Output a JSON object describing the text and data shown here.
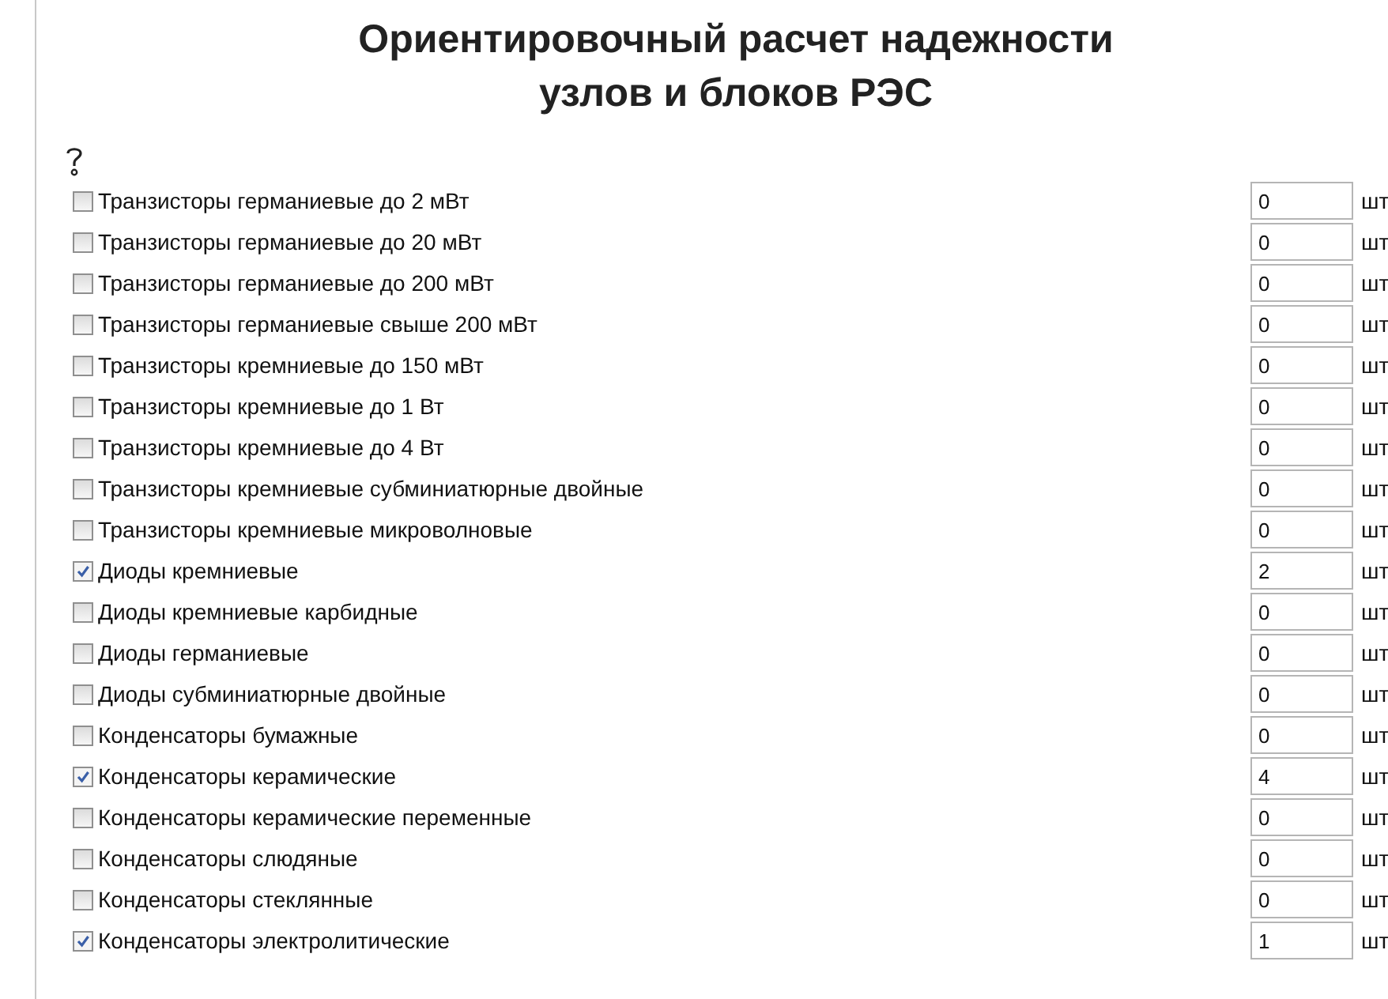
{
  "title": "Ориентировочный расчет надежности узлов и блоков РЭС",
  "items": [
    {
      "label": "Транзисторы германиевые до 2 мВт",
      "checked": false,
      "value": "0",
      "unit": "шт"
    },
    {
      "label": "Транзисторы германиевые до 20 мВт",
      "checked": false,
      "value": "0",
      "unit": "шт"
    },
    {
      "label": "Транзисторы германиевые до 200 мВт",
      "checked": false,
      "value": "0",
      "unit": "шт"
    },
    {
      "label": "Транзисторы германиевые свыше 200 мВт",
      "checked": false,
      "value": "0",
      "unit": "шт"
    },
    {
      "label": "Транзисторы кремниевые до 150 мВт",
      "checked": false,
      "value": "0",
      "unit": "шт"
    },
    {
      "label": "Транзисторы кремниевые до 1 Вт",
      "checked": false,
      "value": "0",
      "unit": "шт"
    },
    {
      "label": "Транзисторы кремниевые до 4 Вт",
      "checked": false,
      "value": "0",
      "unit": "шт"
    },
    {
      "label": "Транзисторы кремниевые субминиатюрные двойные",
      "checked": false,
      "value": "0",
      "unit": "шт"
    },
    {
      "label": "Транзисторы кремниевые микроволновые",
      "checked": false,
      "value": "0",
      "unit": "шт"
    },
    {
      "label": "Диоды кремниевые",
      "checked": true,
      "value": "2",
      "unit": "шт"
    },
    {
      "label": "Диоды кремниевые карбидные",
      "checked": false,
      "value": "0",
      "unit": "шт"
    },
    {
      "label": "Диоды германиевые",
      "checked": false,
      "value": "0",
      "unit": "шт"
    },
    {
      "label": "Диоды субминиатюрные двойные",
      "checked": false,
      "value": "0",
      "unit": "шт"
    },
    {
      "label": "Конденсаторы бумажные",
      "checked": false,
      "value": "0",
      "unit": "шт"
    },
    {
      "label": "Конденсаторы керамические",
      "checked": true,
      "value": "4",
      "unit": "шт"
    },
    {
      "label": "Конденсаторы керамические переменные",
      "checked": false,
      "value": "0",
      "unit": "шт"
    },
    {
      "label": "Конденсаторы слюдяные",
      "checked": false,
      "value": "0",
      "unit": "шт"
    },
    {
      "label": "Конденсаторы стеклянные",
      "checked": false,
      "value": "0",
      "unit": "шт"
    },
    {
      "label": "Конденсаторы электролитические",
      "checked": true,
      "value": "1",
      "unit": "шт"
    }
  ]
}
